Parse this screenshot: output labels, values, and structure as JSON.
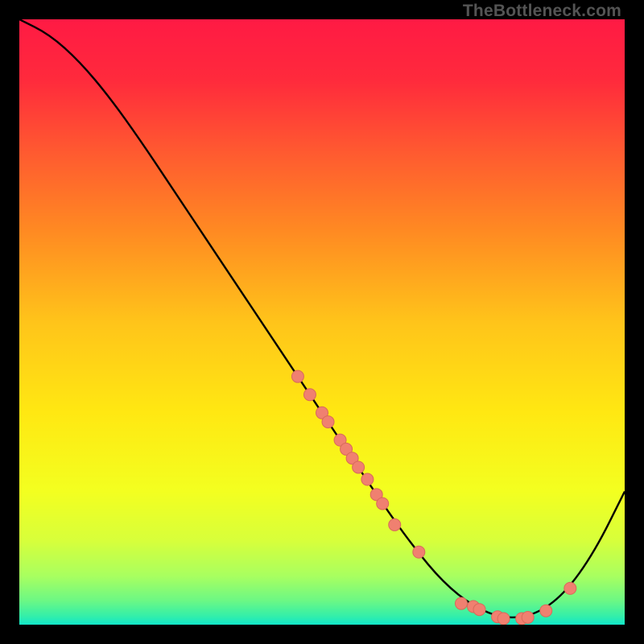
{
  "watermark": "TheBottleneck.com",
  "chart_data": {
    "type": "line",
    "title": "",
    "xlabel": "",
    "ylabel": "",
    "xlim": [
      0,
      100
    ],
    "ylim": [
      0,
      100
    ],
    "curve": {
      "x": [
        0,
        5,
        10,
        15,
        20,
        25,
        30,
        35,
        40,
        45,
        50,
        55,
        60,
        65,
        70,
        75,
        80,
        85,
        90,
        95,
        100
      ],
      "y": [
        100,
        97.5,
        93,
        87,
        80,
        72.5,
        65,
        57.5,
        50,
        42.5,
        35,
        27.5,
        20,
        13,
        7,
        3,
        1,
        1.5,
        5,
        12,
        22
      ]
    },
    "points": [
      {
        "x": 46,
        "y": 41
      },
      {
        "x": 48,
        "y": 38
      },
      {
        "x": 50,
        "y": 35
      },
      {
        "x": 51,
        "y": 33.5
      },
      {
        "x": 53,
        "y": 30.5
      },
      {
        "x": 54,
        "y": 29
      },
      {
        "x": 55,
        "y": 27.5
      },
      {
        "x": 56,
        "y": 26
      },
      {
        "x": 57.5,
        "y": 24
      },
      {
        "x": 59,
        "y": 21.5
      },
      {
        "x": 60,
        "y": 20
      },
      {
        "x": 62,
        "y": 16.5
      },
      {
        "x": 66,
        "y": 12
      },
      {
        "x": 73,
        "y": 3.5
      },
      {
        "x": 75,
        "y": 3
      },
      {
        "x": 76,
        "y": 2.5
      },
      {
        "x": 79,
        "y": 1.3
      },
      {
        "x": 80,
        "y": 1
      },
      {
        "x": 83,
        "y": 1
      },
      {
        "x": 84,
        "y": 1.2
      },
      {
        "x": 87,
        "y": 2.3
      },
      {
        "x": 91,
        "y": 6
      }
    ],
    "gradient_stops": [
      {
        "offset": 0.0,
        "color": "#ff1a44"
      },
      {
        "offset": 0.1,
        "color": "#ff2a3c"
      },
      {
        "offset": 0.22,
        "color": "#ff5a30"
      },
      {
        "offset": 0.35,
        "color": "#ff8a22"
      },
      {
        "offset": 0.5,
        "color": "#ffc41a"
      },
      {
        "offset": 0.65,
        "color": "#ffe812"
      },
      {
        "offset": 0.78,
        "color": "#f3ff20"
      },
      {
        "offset": 0.86,
        "color": "#d8ff3a"
      },
      {
        "offset": 0.92,
        "color": "#a8ff60"
      },
      {
        "offset": 0.96,
        "color": "#6cf884"
      },
      {
        "offset": 0.985,
        "color": "#35efa8"
      },
      {
        "offset": 1.0,
        "color": "#12e6c9"
      }
    ],
    "point_fill": "#f08070",
    "point_stroke": "#d86a5a",
    "curve_color": "#000000"
  }
}
